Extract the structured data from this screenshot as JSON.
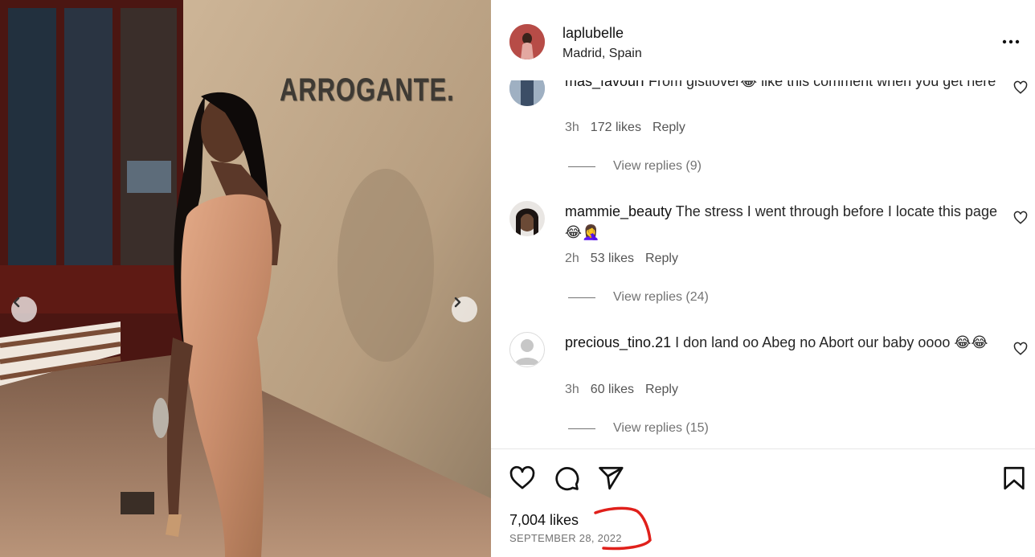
{
  "post": {
    "wall_sign": "ARROGANTE.",
    "likes": "7,004 likes",
    "date": "SEPTEMBER 28, 2022"
  },
  "header": {
    "username": "laplubelle",
    "location": "Madrid, Spain"
  },
  "comments": [
    {
      "user": "mas_favourI",
      "text": " From gistlover😂 like this comment when you get here",
      "age": "3h",
      "likes": "172 likes",
      "reply": "Reply",
      "view_replies": "View replies (9)"
    },
    {
      "user": "mammie_beauty",
      "text": " The stress I went through before I locate this page 😂🤦‍♀️",
      "age": "2h",
      "likes": "53 likes",
      "reply": "Reply",
      "view_replies": "View replies (24)"
    },
    {
      "user": "precious_tino.21",
      "text": " I don land oo Abeg no Abort our baby oooo 😂😂",
      "age": "3h",
      "likes": "60 likes",
      "reply": "Reply",
      "view_replies": "View replies (15)"
    }
  ],
  "icons": [
    "heart-icon",
    "comment-icon",
    "share-icon",
    "bookmark-icon",
    "more-icon",
    "chevron-left-icon",
    "chevron-right-icon"
  ],
  "colors": {
    "annotation": "#e0201b",
    "text_muted": "#737373"
  }
}
